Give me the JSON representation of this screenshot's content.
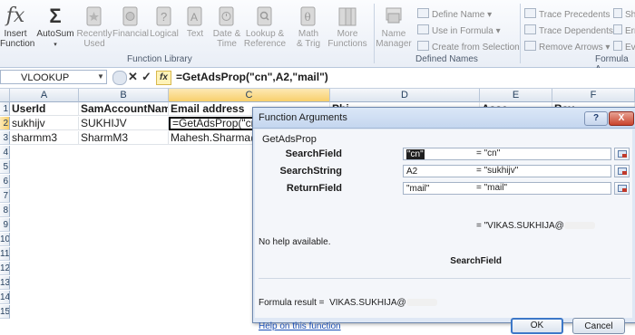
{
  "ribbon": {
    "buttons": [
      {
        "label": "Insert",
        "sub": "Function"
      },
      {
        "label": "AutoSum",
        "sub": ""
      },
      {
        "label": "Recently",
        "sub": "Used"
      },
      {
        "label": "Financial",
        "sub": ""
      },
      {
        "label": "Logical",
        "sub": ""
      },
      {
        "label": "Text",
        "sub": ""
      },
      {
        "label": "Date &",
        "sub": "Time"
      },
      {
        "label": "Lookup &",
        "sub": "Reference"
      },
      {
        "label": "Math",
        "sub": "& Trig"
      },
      {
        "label": "More",
        "sub": "Functions"
      },
      {
        "label": "Name",
        "sub": "Manager"
      }
    ],
    "defined_names": [
      "Define Name",
      "Use in Formula",
      "Create from Selection"
    ],
    "auditing": [
      "Trace Precedents",
      "Trace Dependents",
      "Remove Arrows"
    ],
    "auditing_extra": [
      "Sh",
      "Err",
      "Ev"
    ],
    "groups": {
      "function_library": "Function Library",
      "defined_names": "Defined Names",
      "formula_auditing": "Formula A"
    }
  },
  "formula_bar": {
    "name_box": "VLOOKUP",
    "formula": "=GetAdsProp(\"cn\",A2,\"mail\")",
    "fx": "fx"
  },
  "sheet": {
    "columns": [
      "A",
      "B",
      "C",
      "D",
      "E",
      "F"
    ],
    "rows": [
      "1",
      "2",
      "3",
      "4",
      "5",
      "6",
      "7",
      "8",
      "9",
      "10",
      "11",
      "12",
      "13",
      "14",
      "15"
    ],
    "cells": {
      "A1": "UserId",
      "B1": "SamAccountName",
      "C1": "Email address",
      "A2": "sukhijv",
      "B2": "SUKHIJV",
      "C2": "=GetAdsProp(\"cn\",A",
      "A3": "sharmm3",
      "B3": "SharmM3",
      "C3": "Mahesh.Sharma@",
      "D1": "Phi",
      "E1": "Asse",
      "F1": "Bay"
    }
  },
  "dialog": {
    "title": "Function Arguments",
    "function_name": "GetAdsProp",
    "args": [
      {
        "label": "SearchField",
        "value": "\"cn\"",
        "result": "= \"cn\""
      },
      {
        "label": "SearchString",
        "value": "A2",
        "result": "= \"sukhijv\""
      },
      {
        "label": "ReturnField",
        "value": "\"mail\"",
        "result": "= \"mail\""
      }
    ],
    "result_eq": "= \"VIKAS.SUKHIJA@",
    "no_help": "No help available.",
    "arg_description": "SearchField",
    "formula_result_label": "Formula result =",
    "formula_result_value": "VIKAS.SUKHIJA@",
    "help_link": "Help on this function",
    "ok": "OK",
    "cancel": "Cancel",
    "help_button": "?",
    "close_button": "X"
  }
}
